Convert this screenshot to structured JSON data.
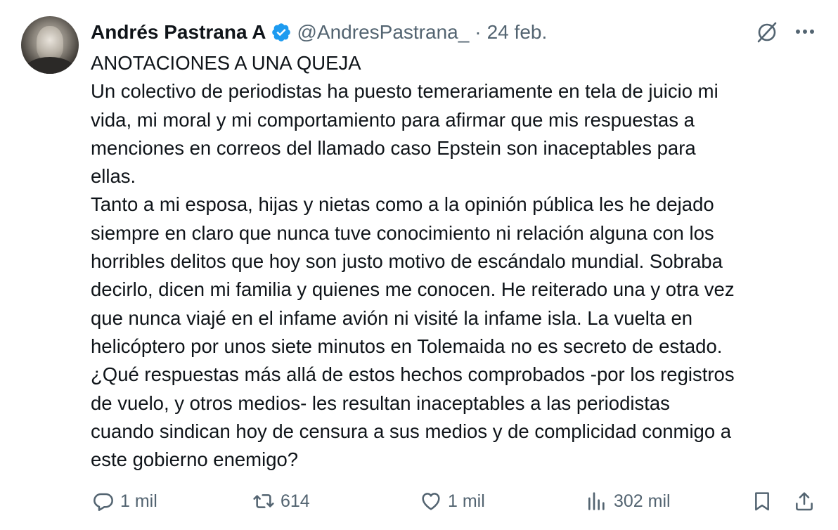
{
  "tweet": {
    "author_name": "Andrés Pastrana A",
    "handle": "@AndresPastrana_",
    "separator": "·",
    "date": "24 feb.",
    "lines": [
      "ANOTACIONES A UNA QUEJA",
      "Un colectivo de periodistas ha puesto temerariamente en tela de juicio mi",
      "vida, mi moral y mi comportamiento para afirmar que mis respuestas a",
      "menciones en correos del llamado caso Epstein son inaceptables para",
      "ellas.",
      "Tanto a mi esposa, hijas y nietas como a la opinión pública les he dejado",
      "siempre en claro que nunca tuve conocimiento ni relación alguna con los",
      "horribles delitos que hoy son justo motivo de escándalo mundial. Sobraba",
      "decirlo, dicen mi familia y quienes me conocen. He reiterado una y otra vez",
      "que nunca viajé en el infame avión ni visité la infame isla. La vuelta en",
      "helicóptero por unos siete minutos en Tolemaida no es secreto de estado.",
      "¿Qué respuestas más allá de estos hechos comprobados -por los registros",
      "de vuelo, y otros medios- les resultan inaceptables a las periodistas",
      "cuando sindican hoy de censura a sus medios y de complicidad conmigo a",
      "este gobierno enemigo?"
    ]
  },
  "actions": {
    "replies": "1 mil",
    "retweets": "614",
    "likes": "1 mil",
    "views": "302 mil"
  },
  "icons": {
    "verified": "verified-badge-icon",
    "grok": "grok-icon",
    "more": "more-icon",
    "reply": "reply-icon",
    "retweet": "retweet-icon",
    "like": "heart-icon",
    "views": "views-icon",
    "bookmark": "bookmark-icon",
    "share": "share-icon"
  },
  "colors": {
    "text": "#0f1419",
    "secondary": "#536471",
    "verified": "#1d9bf0",
    "background": "#ffffff"
  }
}
